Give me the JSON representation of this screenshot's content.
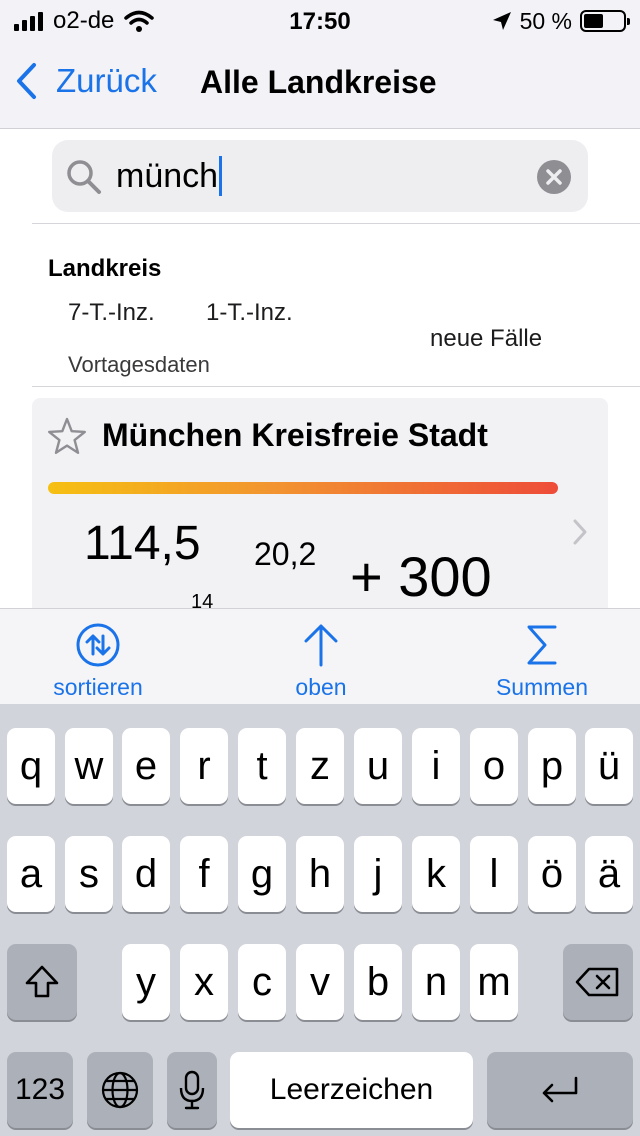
{
  "status": {
    "carrier": "o2-de",
    "time": "17:50",
    "battery": "50 %"
  },
  "nav": {
    "back_label": "Zurück",
    "title": "Alle Landkreise"
  },
  "search": {
    "value": "münch"
  },
  "header": {
    "title": "Landkreis",
    "col1": "7-T.-Inz.",
    "col2": "1-T.-Inz.",
    "col3": "neue Fälle",
    "sub": "Vortagesdaten"
  },
  "result": {
    "name": "München Kreisfreie Stadt",
    "inz7": "114,5",
    "inz1": "20,2",
    "new_cases": "+ 300",
    "sub_value": "14"
  },
  "toolbar": [
    {
      "label": "sortieren",
      "icon": "sort-arrows-icon"
    },
    {
      "label": "oben",
      "icon": "arrow-up-icon"
    },
    {
      "label": "Summen",
      "icon": "sigma-icon"
    }
  ],
  "keyboard": {
    "row1": [
      "q",
      "w",
      "e",
      "r",
      "t",
      "z",
      "u",
      "i",
      "o",
      "p",
      "ü"
    ],
    "row2": [
      "a",
      "s",
      "d",
      "f",
      "g",
      "h",
      "j",
      "k",
      "l",
      "ö",
      "ä"
    ],
    "row3": [
      "y",
      "x",
      "c",
      "v",
      "b",
      "n",
      "m"
    ],
    "numbers_label": "123",
    "space_label": "Leerzeichen"
  },
  "colors": {
    "accent": "#1a73e8",
    "bar_start": "#f6c012",
    "bar_end": "#ee4c38"
  }
}
